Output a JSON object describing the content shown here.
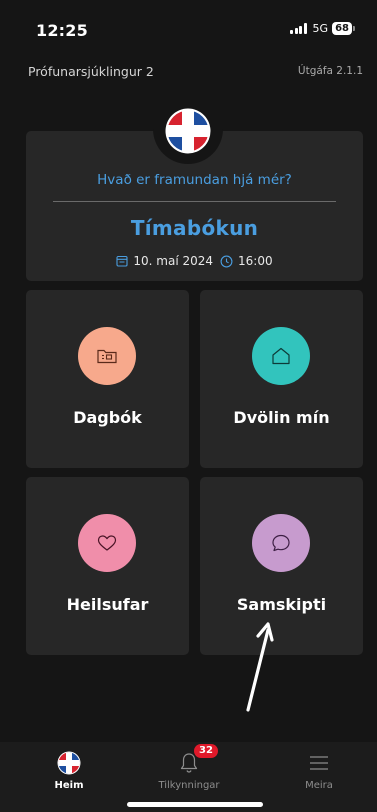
{
  "status_bar": {
    "time": "12:25",
    "network": "5G",
    "battery": "68"
  },
  "header": {
    "patient_name": "Prófunarsjúklingur 2",
    "version": "Útgáfa 2.1.1"
  },
  "appointment": {
    "question": "Hvað er framundan hjá mér?",
    "title": "Tímabókun",
    "date": "10. maí 2024",
    "time": "16:00"
  },
  "tiles": {
    "diary": {
      "label": "Dagbók",
      "color": "#f7a98c"
    },
    "stay": {
      "label": "Dvölin mín",
      "color": "#32c4bd"
    },
    "health": {
      "label": "Heilsufar",
      "color": "#f08eaa"
    },
    "messages": {
      "label": "Samskipti",
      "color": "#c79bce"
    }
  },
  "bottom_nav": {
    "home_label": "Heim",
    "notifications_label": "Tilkynningar",
    "notifications_count": "32",
    "more_label": "Meira"
  },
  "colors": {
    "background": "#151515",
    "card": "#272727",
    "accent_blue": "#4a9ee0",
    "badge_red": "#e0192a"
  }
}
